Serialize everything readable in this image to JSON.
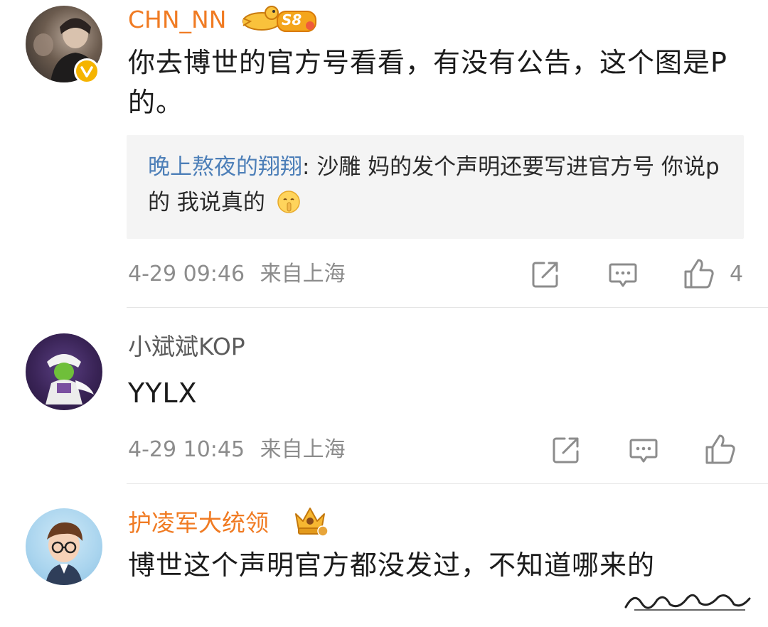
{
  "comments": [
    {
      "username": "CHN_NN",
      "level_badge": "S8",
      "text": "你去博世的官方号看看，有没有公告，这个图是P的。",
      "reply": {
        "name": "晚上熬夜的翔翔",
        "separator": ": ",
        "text": "沙雕 妈的发个声明还要写进官方号 你说p的 我说真的"
      },
      "time": "4-29 09:46",
      "location": "来自上海",
      "like_count": "4"
    },
    {
      "username": "小斌斌KOP",
      "text": "YYLX",
      "time": "4-29 10:45",
      "location": "来自上海"
    },
    {
      "username": "护凌军大统领",
      "text": "博世这个声明官方都没发过，不知道哪来的"
    }
  ],
  "icons": {
    "share": "share-icon",
    "comment": "comment-icon",
    "like": "thumbs-up-icon",
    "verified": "verified-badge-icon",
    "emoji": "shush-emoji-icon"
  },
  "colors": {
    "username_orange": "#f07b23",
    "reply_name_blue": "#4d7fb8",
    "meta_gray": "#8c8c8c",
    "quote_bg": "#f4f4f4",
    "verified_yellow": "#f5b400"
  }
}
